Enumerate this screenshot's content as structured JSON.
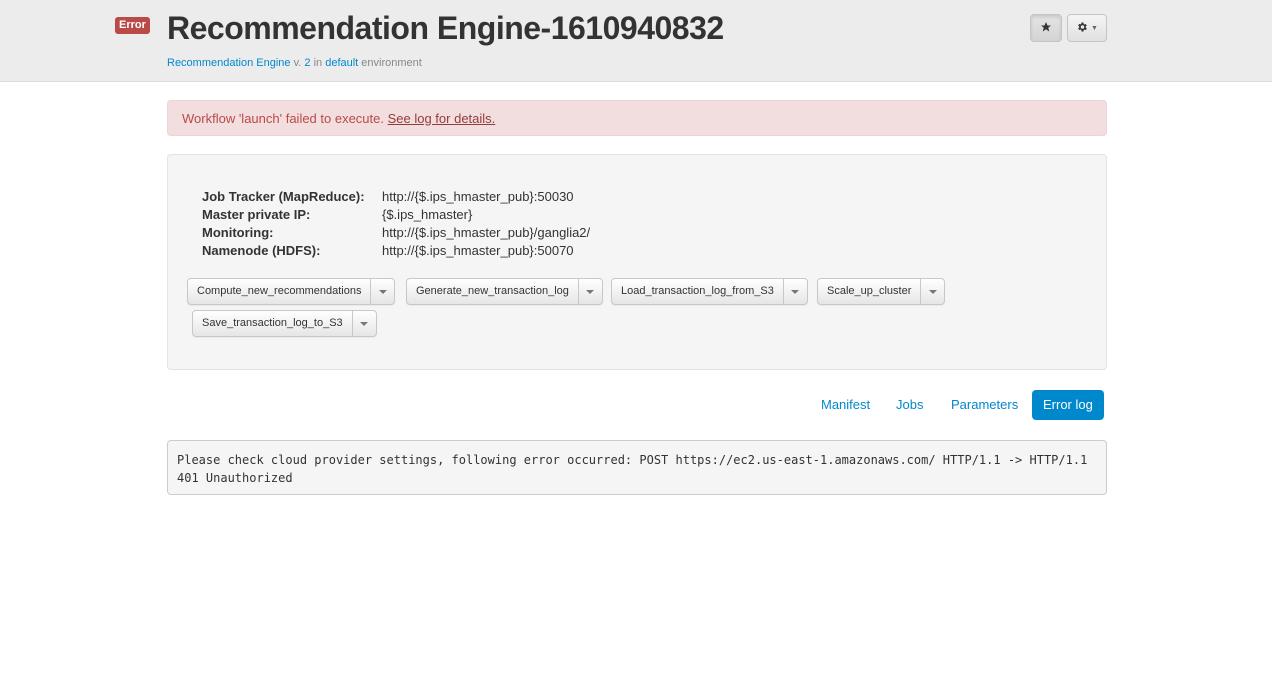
{
  "header": {
    "status_badge": "Error",
    "title": "Recommendation Engine-1610940832",
    "subtitle": {
      "app_link": "Recommendation Engine",
      "version_prefix": " v. ",
      "version": "2",
      "in_text": " in ",
      "env_link": "default",
      "env_suffix": " environment"
    },
    "icons": {
      "star": "star-icon",
      "gear": "gear-icon"
    }
  },
  "alert": {
    "message": "Workflow 'launch' failed to execute. ",
    "link": "See log for details."
  },
  "info": [
    {
      "label": "Job Tracker (MapReduce):",
      "value": "http://{$.ips_hmaster_pub}:50030"
    },
    {
      "label": "Master private IP:",
      "value": "{$.ips_hmaster}"
    },
    {
      "label": "Monitoring:",
      "value": "http://{$.ips_hmaster_pub}/ganglia2/"
    },
    {
      "label": "Namenode (HDFS):",
      "value": "http://{$.ips_hmaster_pub}:50070"
    }
  ],
  "workflows": [
    "Compute_new_recommendations",
    "Generate_new_transaction_log",
    "Load_transaction_log_from_S3",
    "Scale_up_cluster",
    "Save_transaction_log_to_S3"
  ],
  "tabs": [
    {
      "label": "Manifest",
      "active": false
    },
    {
      "label": "Jobs",
      "active": false
    },
    {
      "label": "Parameters",
      "active": false
    },
    {
      "label": "Error log",
      "active": true
    }
  ],
  "error_log": "Please check cloud provider settings, following error occurred: POST https://ec2.us-east-1.amazonaws.com/ HTTP/1.1 -> HTTP/1.1 401 Unauthorized",
  "colors": {
    "accent": "#0088cc",
    "error": "#b94a48",
    "alert_bg": "#f2dede"
  }
}
